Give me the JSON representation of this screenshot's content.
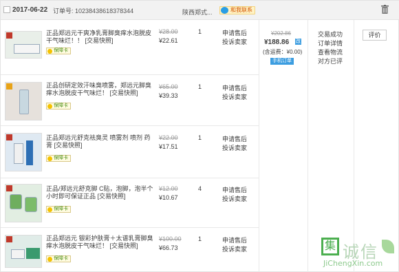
{
  "header": {
    "date": "2017-06-22",
    "order_no_label": "订单号:",
    "order_no": "10238438618378344",
    "shop_name": "陕西郑式...",
    "contact_label": "和我联系"
  },
  "items": [
    {
      "title": "正品郑远元干爽净乳膏脚臭痒水泡脱皮干气味烂！！ [交易快照]",
      "badge": "保障卡",
      "orig_price": "¥28.00",
      "price": "¥22.61",
      "qty": "1",
      "action1": "申请售后",
      "action2": "投诉卖家"
    },
    {
      "title": "正品创研定效汗味臭喷雾，郑远元脚臭痒水泡脱皮干气味烂！ [交易快照]",
      "badge": "保障卡",
      "orig_price": "¥65.00",
      "price": "¥39.33",
      "qty": "1",
      "action1": "申请售后",
      "action2": "投诉卖家"
    },
    {
      "title": "正品郑远元舒克祛臭灵 喷雾剂 喷剂 药膏 [交易快照]",
      "badge": "保障卡",
      "orig_price": "¥22.00",
      "price": "¥17.51",
      "qty": "1",
      "action1": "申请售后",
      "action2": "投诉卖家"
    },
    {
      "title": "正品/郑远元舒克脚 C贴，泡脚，泡半个小时即可保证正品 [交易快照]",
      "badge": "保障卡",
      "orig_price": "¥12.00",
      "price": "¥10.67",
      "qty": "4",
      "action1": "申请售后",
      "action2": "投诉卖家"
    },
    {
      "title": "正品郑远元 银彩护肤膏＋太谱乳膏脚臭痒水泡脱皮干气味烂！ [交易快照]",
      "badge": "保障卡",
      "orig_price": "¥100.00",
      "price": "¥66.73",
      "qty": "1",
      "action1": "申请售后",
      "action2": "投诉卖家"
    }
  ],
  "summary": {
    "total_orig": "¥202.86",
    "paid": "¥188.86",
    "paid_icon": "改",
    "shipping": "(含运费：¥0.00)",
    "mobile_order": "手机订单"
  },
  "status_text": "交易成功 订单详情 查看物流 对方已评",
  "rate_button": "评价",
  "watermark": {
    "chars": "诚信",
    "url": "JiChengXin.com",
    "box_char": "集"
  },
  "colors": {
    "header_bg": "#f2f2f2",
    "accent_blue": "#3c9de0",
    "badge_green": "#4a8f18"
  }
}
